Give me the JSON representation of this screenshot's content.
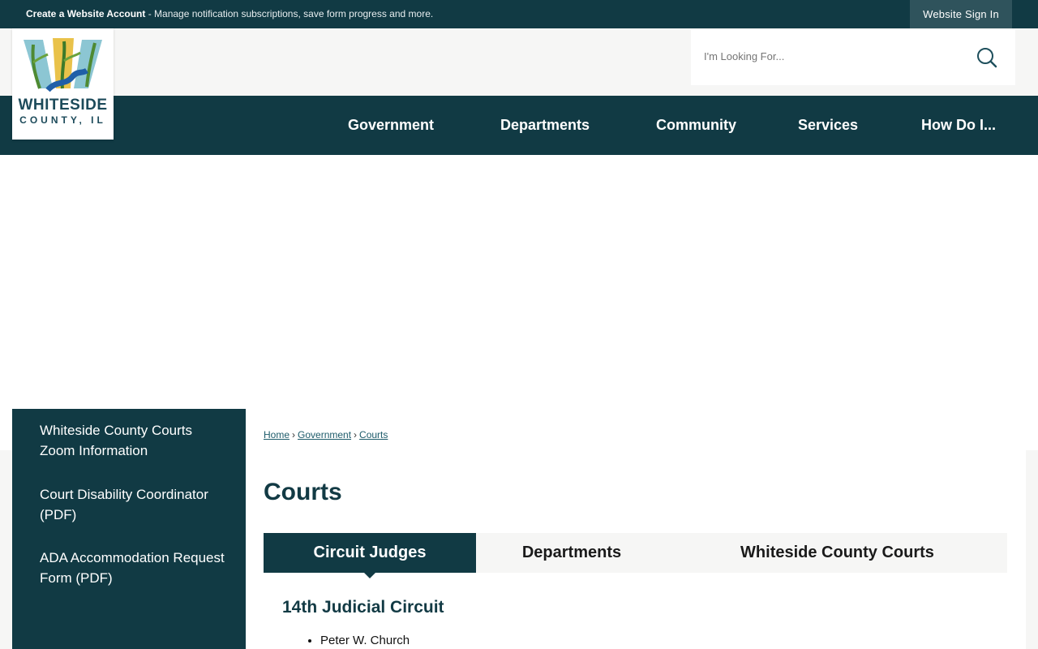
{
  "topbar": {
    "account_link": "Create a Website Account",
    "account_desc": " - Manage notification subscriptions, save form progress and more.",
    "signin_label": "Website Sign In"
  },
  "logo": {
    "line1": "WHITESIDE",
    "line2": "COUNTY, IL"
  },
  "search": {
    "placeholder": "I'm Looking For..."
  },
  "nav": {
    "items": [
      {
        "label": "Government"
      },
      {
        "label": "Departments"
      },
      {
        "label": "Community"
      },
      {
        "label": "Services"
      },
      {
        "label": "How Do I..."
      }
    ]
  },
  "sidebar": {
    "links": [
      {
        "label": "Whiteside County Courts Zoom Information"
      },
      {
        "label": "Court Disability Coordinator (PDF)"
      },
      {
        "label": "ADA Accommodation Request Form (PDF)"
      }
    ]
  },
  "breadcrumb": {
    "items": [
      "Home",
      "Government",
      "Courts"
    ],
    "separator": "›"
  },
  "page": {
    "title": "Courts"
  },
  "tabs": [
    {
      "label": "Circuit Judges",
      "active": true
    },
    {
      "label": "Departments",
      "active": false
    },
    {
      "label": "Whiteside County Courts",
      "active": false
    }
  ],
  "section": {
    "heading": "14th Judicial Circuit",
    "judges": [
      "Peter W. Church"
    ]
  },
  "colors": {
    "primary": "#113a44",
    "signin_bg": "#2f535c",
    "light_bg": "#f6f6f5",
    "link": "#1d5b6a"
  }
}
